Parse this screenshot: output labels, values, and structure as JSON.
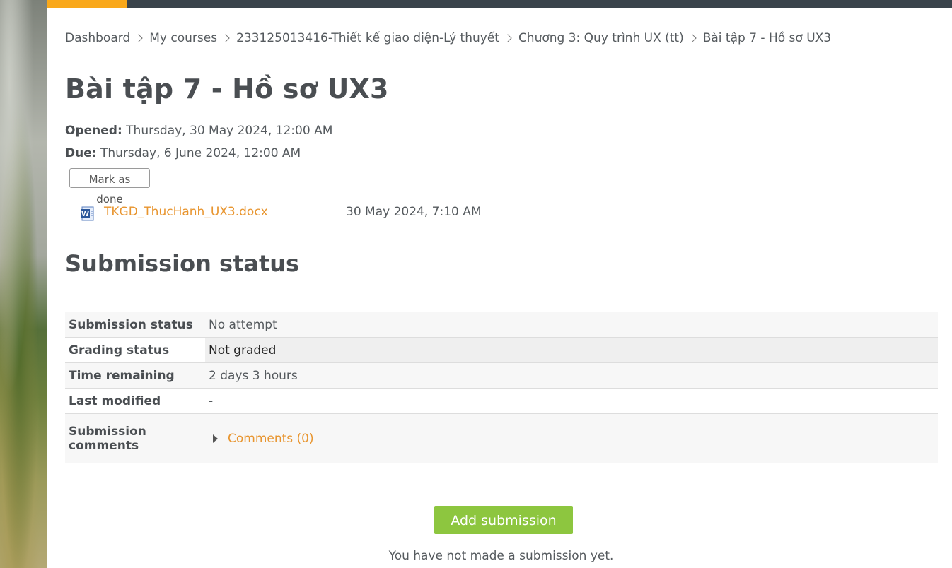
{
  "breadcrumb": [
    {
      "label": "Dashboard"
    },
    {
      "label": "My courses"
    },
    {
      "label": "233125013416-Thiết kế giao diện-Lý thuyết"
    },
    {
      "label": "Chương 3: Quy trình UX (tt)"
    },
    {
      "label": "Bài tập 7 - Hồ sơ UX3"
    }
  ],
  "title": "Bài tập 7 - Hồ sơ UX3",
  "dates": {
    "opened_label": "Opened:",
    "opened_value": "Thursday, 30 May 2024, 12:00 AM",
    "due_label": "Due:",
    "due_value": "Thursday, 6 June 2024, 12:00 AM"
  },
  "mark_done_label": "Mark as done",
  "attachment": {
    "icon": "word-doc-icon",
    "name": "TKGD_ThucHanh_UX3.docx",
    "date": "30 May 2024, 7:10 AM"
  },
  "section_title": "Submission status",
  "status_rows": [
    {
      "label": "Submission status",
      "value": "No attempt"
    },
    {
      "label": "Grading status",
      "value": "Not graded"
    },
    {
      "label": "Time remaining",
      "value": "2 days 3 hours"
    },
    {
      "label": "Last modified",
      "value": "-"
    }
  ],
  "comments_row": {
    "label_line1": "Submission",
    "label_line2": "comments",
    "link": "Comments (0)"
  },
  "add_submission_label": "Add submission",
  "no_submission_text": "You have not made a submission yet.",
  "colors": {
    "accent": "#f9a81b",
    "topbar": "#3a444b",
    "link": "#e8952f",
    "button_green": "#8dc63f"
  }
}
